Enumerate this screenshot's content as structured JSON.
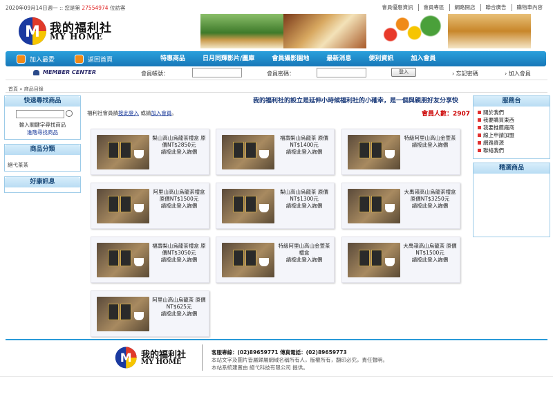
{
  "top": {
    "date_prefix": "2020年09月14日週一 :: 您是第",
    "visitor_count": "27554974",
    "date_suffix": "位訪客",
    "links": [
      "會員優惠資訊",
      "會員專區",
      "網路開店",
      "聯合廣告",
      "購物車內容"
    ]
  },
  "logo": {
    "name": "我的福利社",
    "english": "MY HOME"
  },
  "nav": {
    "add_fav": "加入最愛",
    "home": "返回首頁",
    "items": [
      "特惠商品",
      "日月同輝影片/圖庫",
      "會員攝影園地",
      "最新消息",
      "便利資訊",
      "加入會員"
    ]
  },
  "member": {
    "center": "MEMBER CENTER",
    "account_label": "會員帳號：",
    "password_label": "會員密碼：",
    "login": "登入",
    "forgot": "忘記密碼",
    "join": "加入會員"
  },
  "breadcrumb": "首頁 » 商品目錄",
  "left": {
    "quick_search": "快速尋找商品",
    "search_hint": "輸入關鍵字尋找商品",
    "advanced": "進階尋找商品",
    "categories": "商品分類",
    "category_item": "絕弋茶茶",
    "promo": "好康訊息"
  },
  "main": {
    "slogan": "我的福利社的設立是延伸小時候福利社的小確幸，是一個與親朋好友分享快",
    "member_count_label": "會員人數：",
    "member_count": "2907",
    "note_prefix": "福利社會員請",
    "note_login": "按此登入",
    "note_or": "或請",
    "note_join": "加入會員",
    "note_end": "。",
    "products": [
      {
        "name": "梨山高山烏龍茶禮盒 原價NT$2850元",
        "action": "請按此登入詢價"
      },
      {
        "name": "福壽梨山烏龍茶 原價NT$1400元",
        "action": "請按此登入詢價"
      },
      {
        "name": "特級阿里山高山金萱茶",
        "action": "請按此登入詢價"
      },
      {
        "name": "阿里山高山烏龍茶禮盒 原價NT$1500元",
        "action": "請按此登入詢價"
      },
      {
        "name": "梨山高山烏龍茶 原價NT$1300元",
        "action": "請按此登入詢價"
      },
      {
        "name": "大禹嶺高山烏龍茶禮盒 原價NT$3250元",
        "action": "請按此登入詢價"
      },
      {
        "name": "福壽梨山烏龍茶禮盒 原價NT$3050元",
        "action": "請按此登入詢價"
      },
      {
        "name": "特級阿里山高山金萱茶禮盒",
        "action": "請按此登入詢價"
      },
      {
        "name": "大禹嶺高山烏龍茶 原價NT$1500元",
        "action": "請按此登入詢價"
      },
      {
        "name": "阿里山高山烏龍茶 原價NT$625元",
        "action": "請按此登入詢價"
      }
    ]
  },
  "right": {
    "service": "服務台",
    "service_links": [
      "關於我們",
      "我要購買東西",
      "我要推薦廠商",
      "線上申請加盟",
      "網路資源",
      "聯絡我們"
    ],
    "featured": "精選商品"
  },
  "footer": {
    "contact": "客服專線：(02)89659771 傳真電話：(02)89659773",
    "copyright": "本站文字及圖片皆屬歸屬網域名稱所有人，版權所有，翻印必究，責任聲明。",
    "provider": "本站系統建置由 絕弋科技有限公司 提供。"
  },
  "colors": {
    "accent": "#1c86c8",
    "highlight": "#e02020",
    "panel_border": "#9ccbe8"
  }
}
